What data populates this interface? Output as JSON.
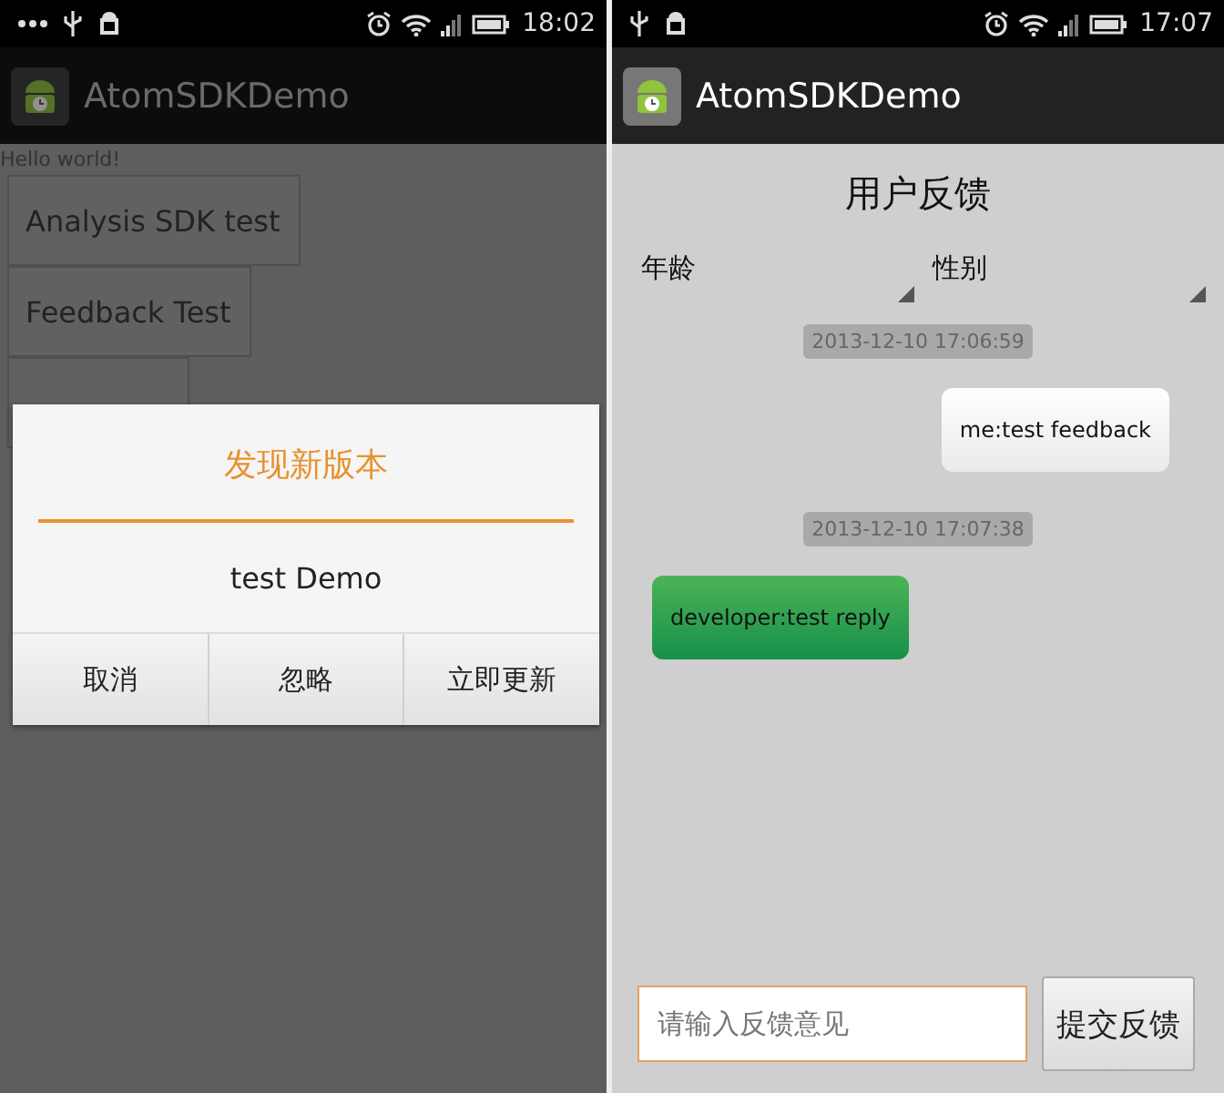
{
  "screens": [
    {
      "kind": "update_dialog",
      "status_bar": {
        "time": "18:02",
        "notification_dots": true
      },
      "app_bar": {
        "title": "AtomSDKDemo"
      },
      "greeting": "Hello world!",
      "buttons": [
        "Analysis SDK test",
        "Feedback Test"
      ],
      "covered_button": true,
      "dialog": {
        "title": "发现新版本",
        "message": "test Demo",
        "buttons": [
          "取消",
          "忽略",
          "立即更新"
        ]
      }
    },
    {
      "kind": "feedback",
      "status_bar": {
        "time": "17:07",
        "notification_dots": false
      },
      "app_bar": {
        "title": "AtomSDKDemo"
      },
      "title": "用户反馈",
      "spinners": [
        {
          "label": "年龄"
        },
        {
          "label": "性别"
        }
      ],
      "messages": [
        {
          "kind": "timestamp",
          "text": "2013-12-10 17:06:59"
        },
        {
          "kind": "sent",
          "text": "me:test feedback"
        },
        {
          "kind": "timestamp",
          "text": "2013-12-10 17:07:38"
        },
        {
          "kind": "received",
          "text": "developer:test reply"
        }
      ],
      "input": {
        "placeholder": "请输入反馈意见"
      },
      "submit": "提交反馈"
    }
  ]
}
